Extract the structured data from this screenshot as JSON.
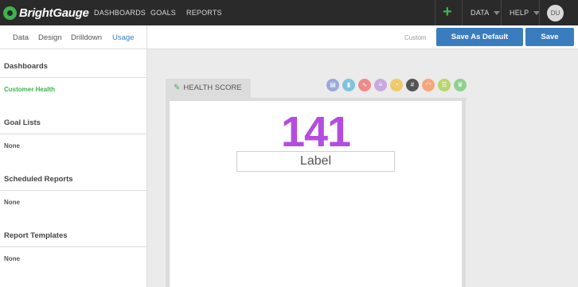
{
  "header": {
    "brand": "BrightGauge",
    "nav": [
      "DASHBOARDS",
      "GOALS",
      "REPORTS"
    ],
    "add_symbol": "+",
    "data_menu": "DATA",
    "help_menu": "HELP",
    "user_initials": "DU"
  },
  "sidebar": {
    "tabs": [
      "Data",
      "Design",
      "Drilldown",
      "Usage"
    ],
    "active_tab": "Usage",
    "sections": [
      {
        "title": "Dashboards",
        "item": "Customer Health"
      },
      {
        "title": "Goal Lists",
        "item": "None"
      },
      {
        "title": "Scheduled Reports",
        "item": "None"
      },
      {
        "title": "Report Templates",
        "item": "None"
      }
    ]
  },
  "toolbar": {
    "custom_label": "Custom",
    "save_default_label": "Save As Default",
    "save_label": "Save"
  },
  "widget": {
    "tab_label": "HEALTH SCORE",
    "value": "141",
    "value_color": "#b44ddf",
    "label": "Label",
    "type_icons": [
      {
        "name": "table",
        "glyph": "▤",
        "color": "#9aa9d8"
      },
      {
        "name": "bar-chart",
        "glyph": "▮",
        "color": "#7ec3e0"
      },
      {
        "name": "line-chart",
        "glyph": "∿",
        "color": "#ef8a8a"
      },
      {
        "name": "stacked-bar",
        "glyph": "≡",
        "color": "#c9a8e0"
      },
      {
        "name": "pie",
        "glyph": "◔",
        "color": "#f0c96a"
      },
      {
        "name": "numeric",
        "glyph": "#",
        "color": "#555555"
      },
      {
        "name": "gauge",
        "glyph": "◠",
        "color": "#f5a77a"
      },
      {
        "name": "list",
        "glyph": "☰",
        "color": "#b8d66a"
      },
      {
        "name": "trophy",
        "glyph": "♛",
        "color": "#8fd18f"
      }
    ]
  }
}
